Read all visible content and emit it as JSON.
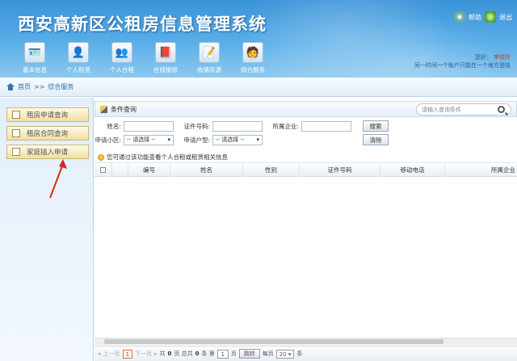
{
  "header": {
    "title": "西安高新区公租房信息管理系统",
    "help_label": "帮助",
    "exit_label": "退出",
    "user_greeting": "您好：",
    "user_name": "李晓玲",
    "notice": "同一时间一个账户只能在一个地方登陆"
  },
  "nav": [
    {
      "label": "基本信息",
      "icon": "info-card-icon"
    },
    {
      "label": "个人租赁",
      "icon": "person-rent-icon"
    },
    {
      "label": "个人合租",
      "icon": "person-share-icon"
    },
    {
      "label": "在线报修",
      "icon": "repair-book-icon"
    },
    {
      "label": "收储房源",
      "icon": "housing-pen-icon"
    },
    {
      "label": "综合服务",
      "icon": "service-person-icon"
    }
  ],
  "breadcrumb": {
    "home": "首页",
    "sep": ">>",
    "current": "综合服务"
  },
  "sidebar": {
    "items": [
      {
        "label": "租房申请查询"
      },
      {
        "label": "租房合同查询"
      },
      {
        "label": "家庭插入申请"
      }
    ]
  },
  "query": {
    "title": "条件查询",
    "search_placeholder": "请输入查询条件",
    "name_label": "姓名:",
    "id_label": "证件号码:",
    "company_label": "所属企业:",
    "search_btn": "搜索",
    "community_label": "申请小区:",
    "community_value": "-- 请选择 --",
    "type_label": "申请户型:",
    "type_value": "-- 请选择 --",
    "clear_btn": "清除"
  },
  "tip": "您可通过该功能查看个人合租或租赁相关信息",
  "table": {
    "columns": [
      "编号",
      "姓名",
      "性别",
      "证件号码",
      "移动电话",
      "所属企业"
    ]
  },
  "pager": {
    "prev": "上一页",
    "current_page": "1",
    "next": "下一页",
    "total_prefix": "共",
    "total_pages": "0",
    "pages_unit": "页 总共",
    "total_items": "0",
    "items_unit": "条 第",
    "goto_page": "1",
    "page_unit": "页",
    "jump_btn": "跳转",
    "per_page_label": "每页",
    "per_page": "20",
    "per_page_unit": "条"
  }
}
